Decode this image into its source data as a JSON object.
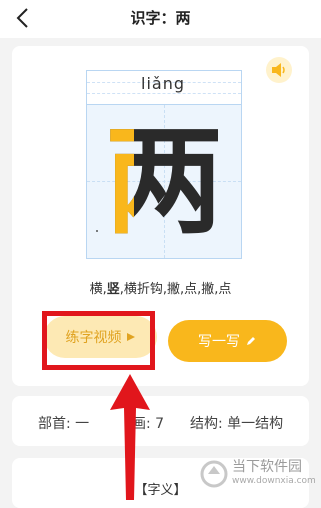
{
  "header": {
    "title": "识字：两"
  },
  "character": {
    "pinyin": "liǎng",
    "glyph": "两"
  },
  "strokes_prefix": "横,",
  "strokes_bold": "竖",
  "strokes_rest": ",横折钩,撇,点,撇,点",
  "buttons": {
    "video_label": "练字视频",
    "write_label": "写一写"
  },
  "info": {
    "radical": "部首: 一",
    "strokes": "画: 7",
    "structure": "结构: 单一结构"
  },
  "meaning_label": "【字义】",
  "watermark": {
    "name": "当下软件园",
    "url": "www.downxia.com"
  },
  "colors": {
    "accent": "#f9b71c",
    "highlight": "#e1161c",
    "grid": "#b9d6f2"
  }
}
